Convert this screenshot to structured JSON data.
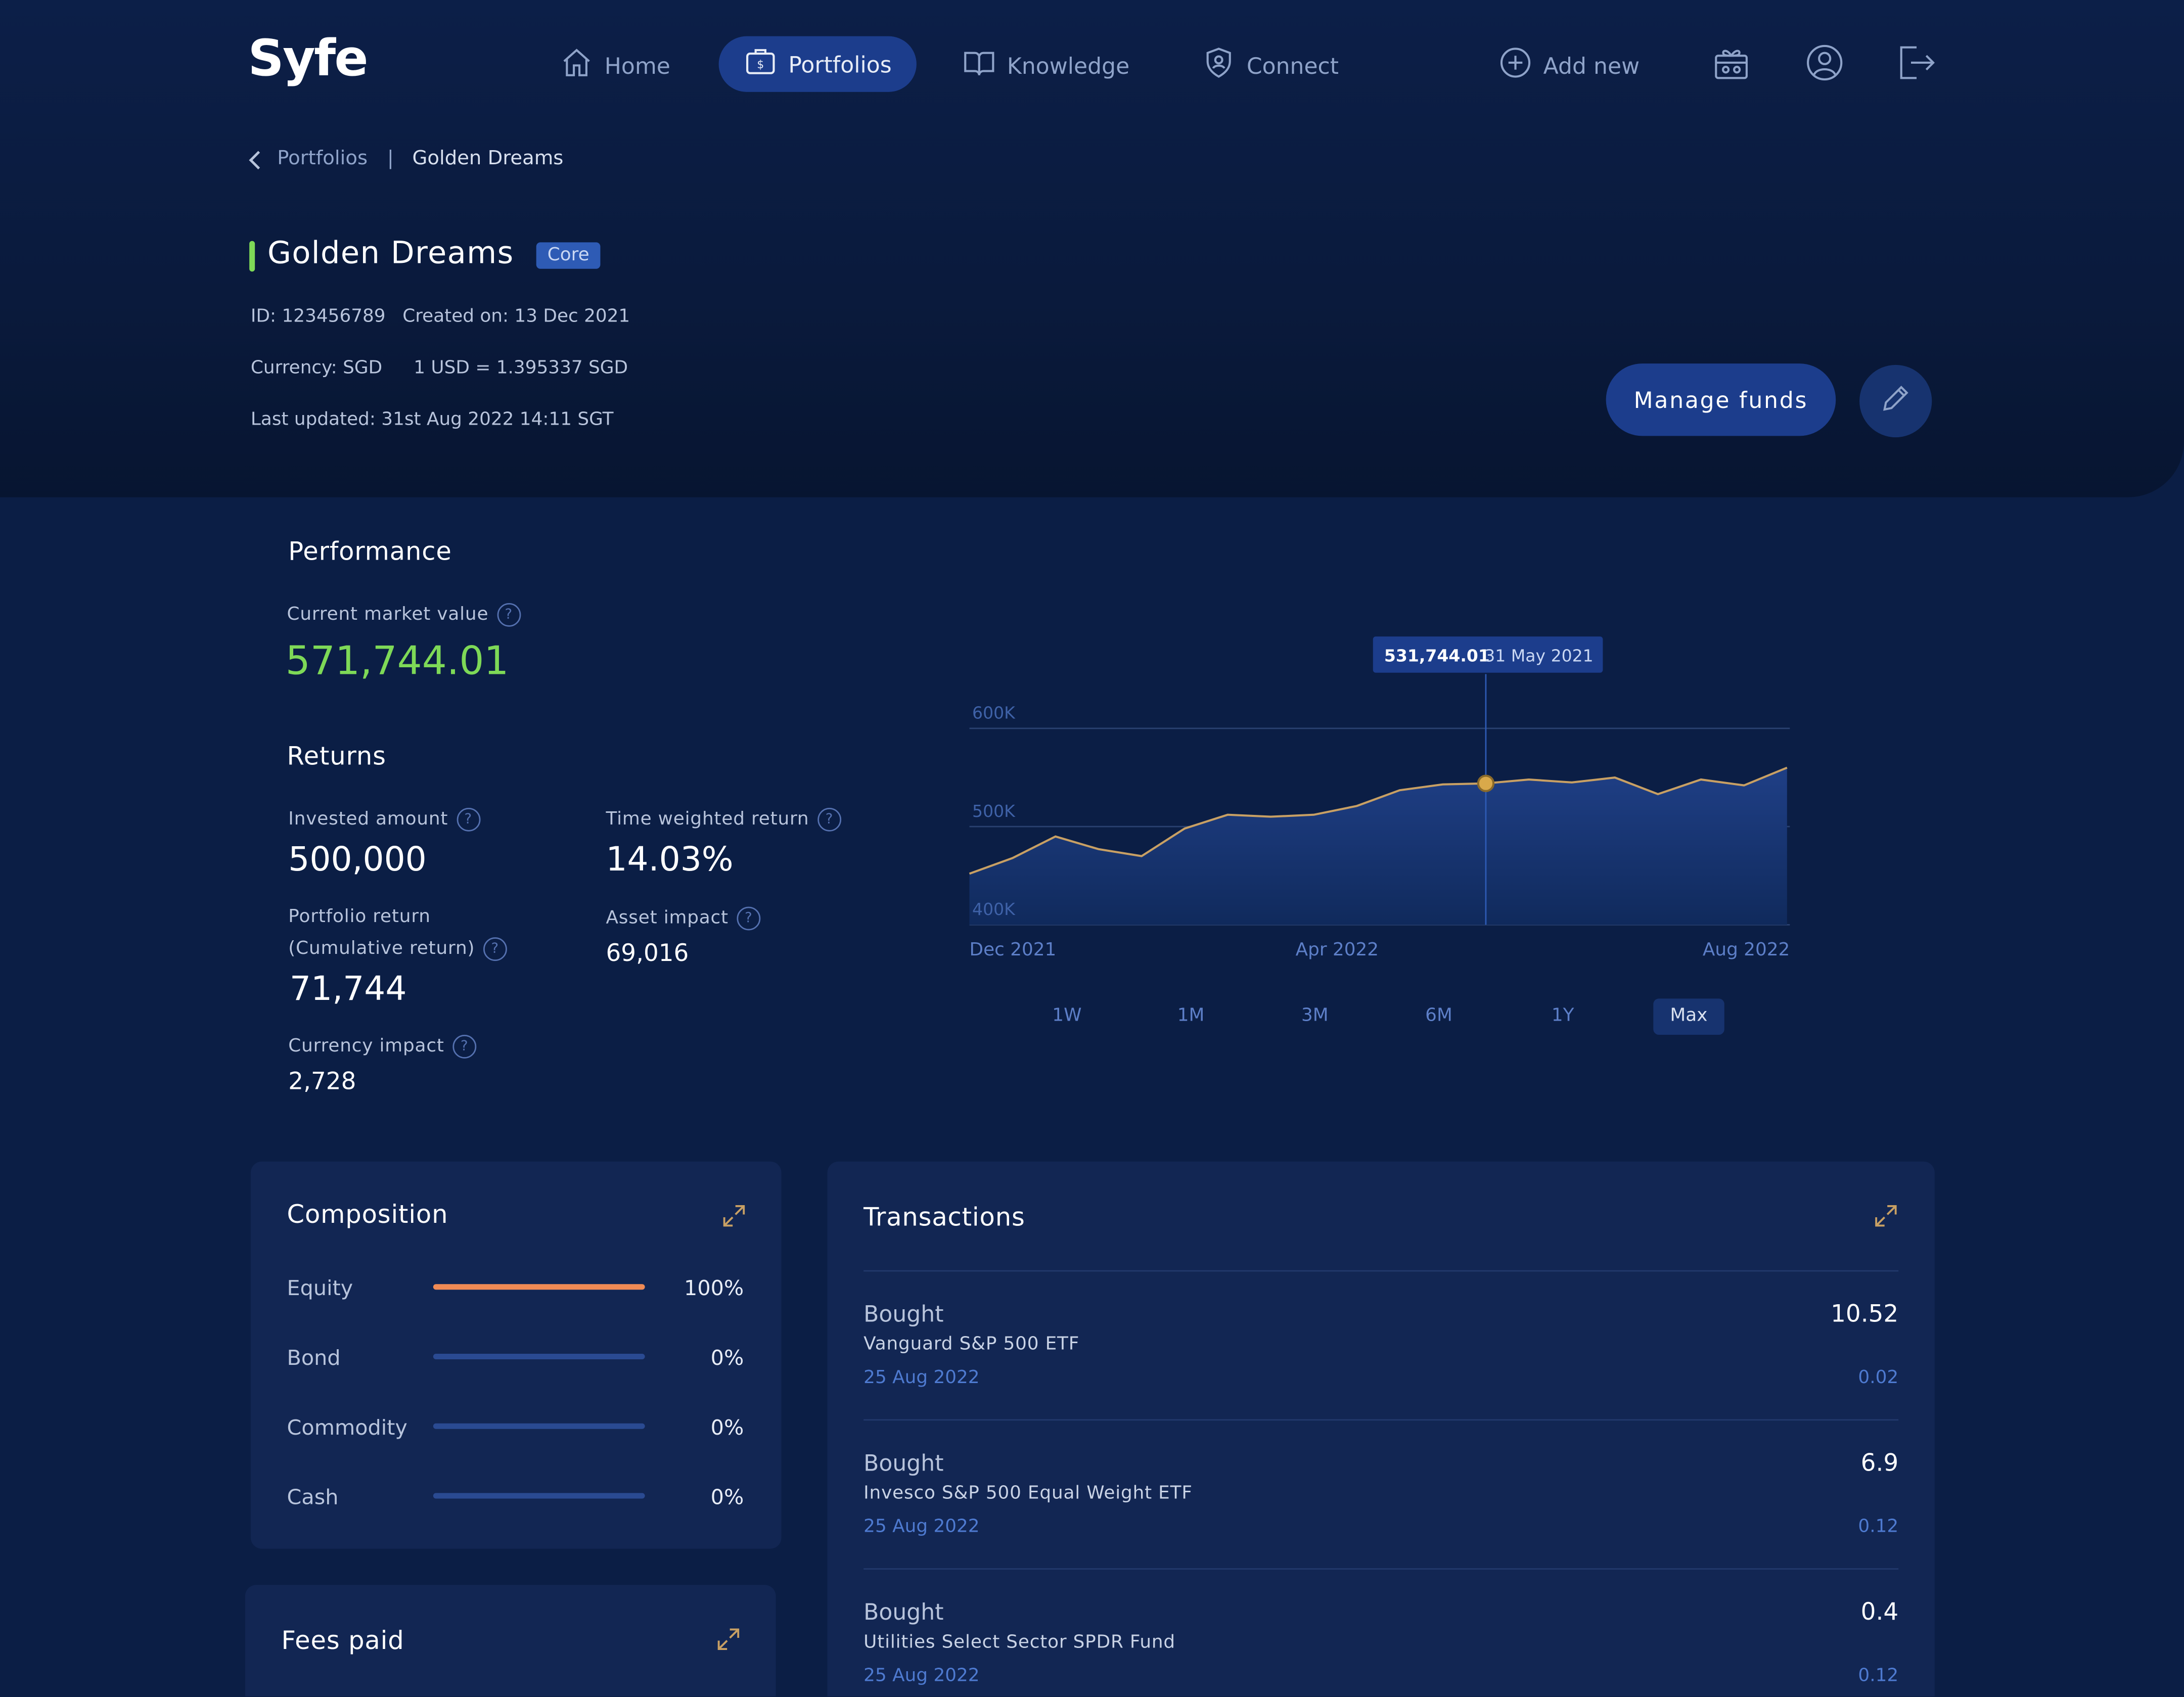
{
  "brand": {
    "logo": "Syfe"
  },
  "nav": {
    "items": [
      {
        "label": "Home",
        "icon": "home-icon"
      },
      {
        "label": "Portfolios",
        "icon": "briefcase-dollar-icon",
        "active": true
      },
      {
        "label": "Knowledge",
        "icon": "book-icon"
      },
      {
        "label": "Connect",
        "icon": "shield-user-icon"
      }
    ],
    "add_new": "Add new",
    "icons": [
      "gift-icon",
      "profile-icon",
      "logout-icon"
    ]
  },
  "breadcrumb": {
    "parent": "Portfolios",
    "separator": "|",
    "current": "Golden Dreams"
  },
  "portfolio": {
    "name": "Golden Dreams",
    "badge": "Core",
    "id": "ID: 123456789",
    "created": "Created on: 13 Dec 2021",
    "currency": "Currency: SGD",
    "fx": "1 USD = 1.395337 SGD",
    "last_updated": "Last updated: 31st Aug 2022 14:11 SGT"
  },
  "actions": {
    "manage_funds": "Manage funds",
    "edit_icon": "pencil-icon"
  },
  "performance": {
    "heading": "Performance",
    "cmv_label": "Current market value",
    "cmv_value": "571,744.01",
    "returns_heading": "Returns",
    "invested_label": "Invested amount",
    "invested_value": "500,000",
    "twr_label": "Time weighted return",
    "twr_value": "14.03%",
    "portfolio_return_label_1": "Portfolio return",
    "portfolio_return_label_2": "(Cumulative return)",
    "portfolio_return_value": "71,744",
    "asset_impact_label": "Asset impact",
    "asset_impact_value": "69,016",
    "currency_impact_label": "Currency impact",
    "currency_impact_value": "2,728",
    "help_glyph": "?"
  },
  "chart_data": {
    "type": "area",
    "x_tick_labels": [
      "Dec 2021",
      "Apr 2022",
      "Aug 2022"
    ],
    "y_tick_labels": [
      "600K",
      "500K",
      "400K"
    ],
    "y_ticks": [
      600000,
      500000,
      400000
    ],
    "ylim": [
      400000,
      600000
    ],
    "grid": true,
    "values": [
      452000,
      468000,
      490000,
      477000,
      470000,
      498000,
      512000,
      510000,
      512000,
      521000,
      537000,
      543000,
      544000,
      548000,
      545000,
      550000,
      533000,
      548000,
      542000,
      560000
    ],
    "tooltip": {
      "value": "531,744.01",
      "date": "31 May 2021",
      "index": 12
    },
    "ranges": [
      "1W",
      "1M",
      "3M",
      "6M",
      "1Y",
      "Max"
    ],
    "active_range": "Max",
    "colors": {
      "line": "#c8a064",
      "fill_top": "#1f3f86",
      "fill_bottom": "#102a5c",
      "marker": "#d9a94a"
    }
  },
  "composition": {
    "title": "Composition",
    "items": [
      {
        "label": "Equity",
        "pct": "100%",
        "fraction": 1.0
      },
      {
        "label": "Bond",
        "pct": "0%",
        "fraction": 0
      },
      {
        "label": "Commodity",
        "pct": "0%",
        "fraction": 0
      },
      {
        "label": "Cash",
        "pct": "0%",
        "fraction": 0
      }
    ],
    "colors": {
      "fill": "#f08a54",
      "track": "#2a4a92"
    }
  },
  "transactions": {
    "title": "Transactions",
    "items": [
      {
        "action": "Bought",
        "name": "Vanguard S&P 500 ETF",
        "date": "25 Aug 2022",
        "qty": "10.52",
        "price": "0.02"
      },
      {
        "action": "Bought",
        "name": "Invesco S&P 500 Equal Weight ETF",
        "date": "25 Aug 2022",
        "qty": "6.9",
        "price": "0.12"
      },
      {
        "action": "Bought",
        "name": "Utilities Select Sector SPDR Fund",
        "date": "25 Aug 2022",
        "qty": "0.4",
        "price": "0.12"
      }
    ]
  },
  "fees": {
    "title": "Fees paid"
  },
  "expand_icon": "expand-icon"
}
